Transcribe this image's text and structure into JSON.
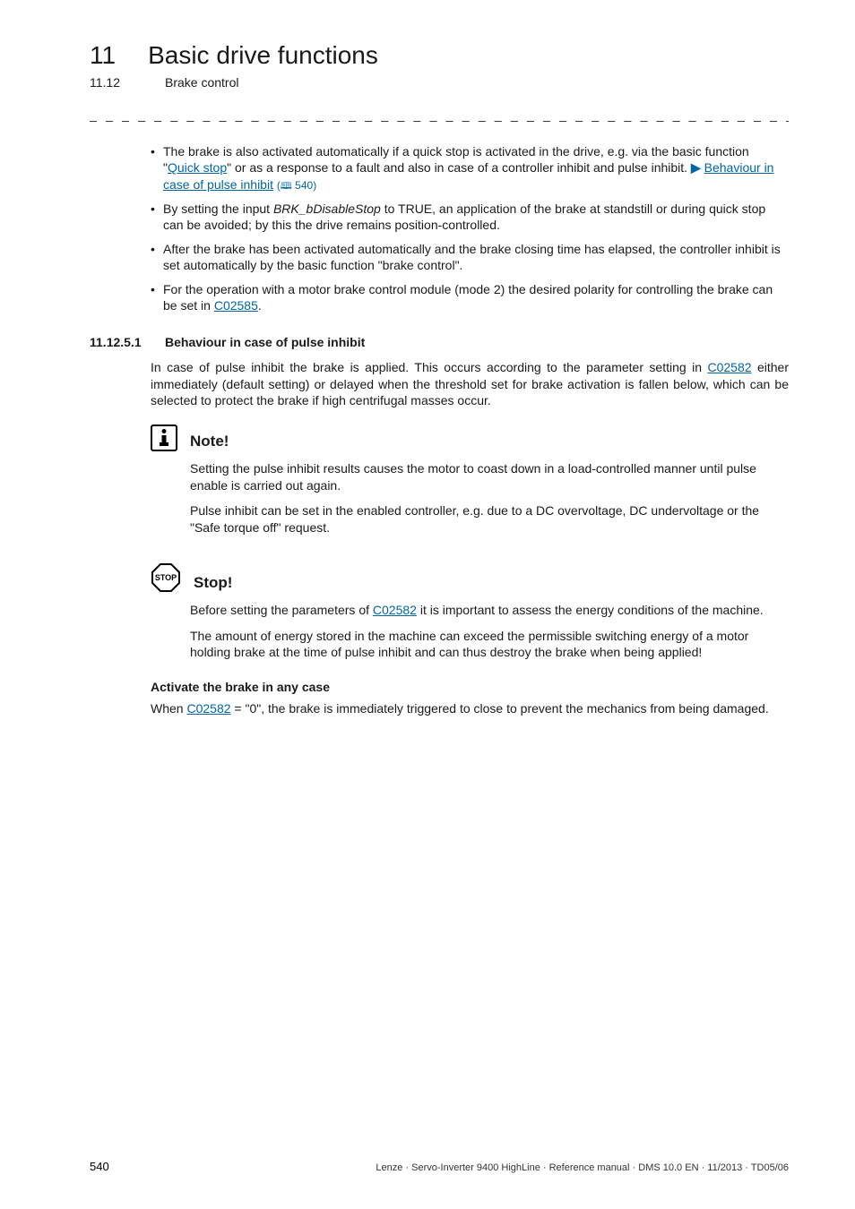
{
  "chapter": {
    "number": "11",
    "title": "Basic drive functions"
  },
  "section": {
    "number": "11.12",
    "title": "Brake control"
  },
  "dashes": "_ _ _ _ _ _ _ _ _ _ _ _ _ _ _ _ _ _ _ _ _ _ _ _ _ _ _ _ _ _ _ _ _ _ _ _ _ _ _ _ _ _ _ _ _ _ _ _ _ _ _ _ _ _ _ _ _ _ _ _ _ _ _ _",
  "bullets": {
    "b0": {
      "t1": "The brake is also activated automatically if a quick stop is activated in the drive, e.g. via the basic function \"",
      "link1": "Quick stop",
      "t2": "\" or as a response to a fault and also in case of a controller inhibit and pulse inhibit.  ",
      "arrow": "▶",
      "link2": "Behaviour in case of pulse inhibit",
      "pageref_icon": "🕮",
      "pageref": " 540)"
    },
    "b1": {
      "t1": "By setting the input ",
      "italic": "BRK_bDisableStop",
      "t2": " to TRUE, an application of the brake at standstill or during quick stop can be avoided; by this the drive remains position-controlled."
    },
    "b2": {
      "text": "After the brake has been activated automatically and the brake closing time has elapsed, the controller inhibit is set automatically by the basic function \"brake control\"."
    },
    "b3": {
      "t1": "For the operation with a motor brake control module (mode 2) the desired polarity for controlling the brake can be set in ",
      "link": "C02585",
      "t2": "."
    }
  },
  "subsection": {
    "number": "11.12.5.1",
    "title": "Behaviour in case of pulse inhibit",
    "para_t1": "In case of pulse inhibit the brake is applied. This occurs according to the parameter setting in ",
    "para_link": "C02582",
    "para_t2": " either immediately (default setting) or delayed when the threshold set for brake activation is fallen below, which can be selected to protect the brake if high centrifugal masses occur."
  },
  "note": {
    "title": "Note!",
    "p1": "Setting the pulse inhibit results causes the motor to coast down in a load-controlled manner until pulse enable is carried out again.",
    "p2": "Pulse inhibit can be set in the enabled controller, e.g. due to a DC overvoltage, DC undervoltage or the \"Safe torque off\" request."
  },
  "stop": {
    "title": "Stop!",
    "p1_t1": "Before setting the parameters of ",
    "p1_link": "C02582",
    "p1_t2": " it is important to assess the energy conditions of the machine.",
    "p2": "The amount of energy stored in the machine can exceed the permissible switching energy of a motor holding brake at the time of pulse inhibit and can thus destroy the brake when being applied!"
  },
  "activate": {
    "heading": "Activate the brake in any case",
    "t1": "When ",
    "link": "C02582",
    "t2": " = \"0\", the brake is immediately triggered to close to prevent the mechanics from being damaged."
  },
  "footer": {
    "page": "540",
    "right": "Lenze · Servo-Inverter 9400 HighLine · Reference manual · DMS 10.0 EN · 11/2013 · TD05/06"
  }
}
